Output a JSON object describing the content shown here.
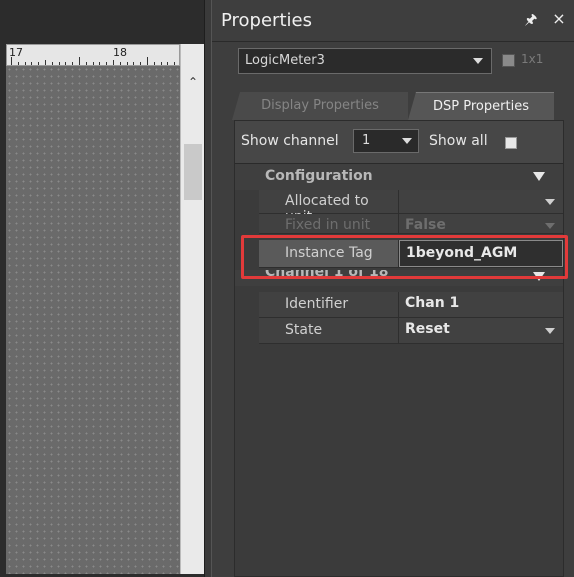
{
  "ruler": {
    "marks": [
      "17",
      "18"
    ]
  },
  "properties": {
    "title": "Properties",
    "device": {
      "selected": "LogicMeter3"
    },
    "lock": {
      "label": "1x1",
      "checked": false
    },
    "tabs": [
      {
        "label": "Display Properties",
        "active": false
      },
      {
        "label": "DSP Properties",
        "active": true
      }
    ],
    "show_channel": {
      "label": "Show channel",
      "value": "1"
    },
    "show_all": {
      "label": "Show all",
      "checked": false
    },
    "sections": [
      {
        "label": "Configuration",
        "rows": [
          {
            "name": "Allocated to unit",
            "value": "",
            "dropdown": true,
            "dim": false
          },
          {
            "name": "Fixed in unit",
            "value": "False",
            "dropdown": true,
            "dim": true
          },
          {
            "name": "Instance Tag",
            "value": "1beyond_AGM",
            "dropdown": false,
            "dim": false
          }
        ]
      },
      {
        "label": "Channel 1 of 18",
        "rows": [
          {
            "name": "Identifier",
            "value": "Chan 1",
            "dropdown": false,
            "dim": false
          },
          {
            "name": "State",
            "value": "Reset",
            "dropdown": true,
            "dim": false
          }
        ]
      }
    ]
  },
  "colors": {
    "highlight": "#e23a3a",
    "panel_bg": "#3e3e3e"
  },
  "icons": {
    "pin": "pin-icon",
    "close": "close-icon",
    "scroll_up": "chevron-up-icon"
  }
}
